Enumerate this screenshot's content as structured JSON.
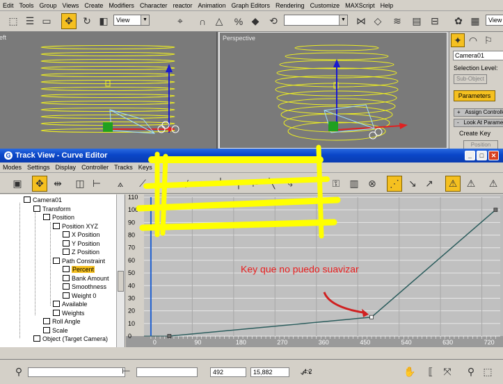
{
  "menubar": {
    "items": [
      "Edit",
      "Tools",
      "Group",
      "Views",
      "Create",
      "Modifiers",
      "Character",
      "reactor",
      "Animation",
      "Graph Editors",
      "Rendering",
      "Customize",
      "MAXScript",
      "Help"
    ]
  },
  "toolbar": {
    "view_select": "View",
    "view_select_right": "View"
  },
  "viewports": {
    "left_label": "Left",
    "persp_label": "Perspective"
  },
  "command_panel": {
    "object_name": "Camera01",
    "selection_level": "Selection Level:",
    "sub_object": "Sub-Object",
    "parameters": "Parameters",
    "rollouts": [
      "Assign Controller",
      "Look At Parameters"
    ],
    "create_key": "Create Key",
    "position": "Position"
  },
  "trackview": {
    "title": "Track View - Curve Editor",
    "menu": [
      "Modes",
      "Settings",
      "Display",
      "Controller",
      "Tracks",
      "Keys"
    ],
    "tree": [
      {
        "label": "Camera01",
        "indent": 0,
        "selected": false
      },
      {
        "label": "Transform",
        "indent": 1,
        "selected": false
      },
      {
        "label": "Position",
        "indent": 2,
        "selected": false
      },
      {
        "label": "Position XYZ",
        "indent": 3,
        "selected": false
      },
      {
        "label": "X Position",
        "indent": 4,
        "selected": false
      },
      {
        "label": "Y Position",
        "indent": 4,
        "selected": false
      },
      {
        "label": "Z Position",
        "indent": 4,
        "selected": false
      },
      {
        "label": "Path Constraint",
        "indent": 3,
        "selected": false
      },
      {
        "label": "Percent",
        "indent": 4,
        "selected": true
      },
      {
        "label": "Bank Amount",
        "indent": 4,
        "selected": false
      },
      {
        "label": "Smoothness",
        "indent": 4,
        "selected": false
      },
      {
        "label": "Weight 0",
        "indent": 4,
        "selected": false
      },
      {
        "label": "Available",
        "indent": 3,
        "selected": false
      },
      {
        "label": "Weights",
        "indent": 3,
        "selected": false
      },
      {
        "label": "Roll Angle",
        "indent": 2,
        "selected": false
      },
      {
        "label": "Scale",
        "indent": 2,
        "selected": false
      },
      {
        "label": "Object (Target Camera)",
        "indent": 1,
        "selected": false
      }
    ],
    "annotation": "Key que no puedo suavizar"
  },
  "chart_data": {
    "type": "line",
    "title": "",
    "xlabel": "",
    "ylabel": "",
    "xlim": [
      -15,
      760
    ],
    "ylim": [
      0,
      110
    ],
    "x_ticks": [
      "0",
      "90",
      "180",
      "270",
      "360",
      "450",
      "540",
      "630",
      "720"
    ],
    "y_ticks": [
      "0",
      "10",
      "20",
      "30",
      "40",
      "50",
      "60",
      "70",
      "80",
      "90",
      "100",
      "110"
    ],
    "series": [
      {
        "name": "Percent",
        "x": [
          40,
          480,
          750
        ],
        "y": [
          0,
          15,
          100
        ]
      }
    ],
    "grid": true
  },
  "status": {
    "frame_field": "492",
    "value_field": "15,882",
    "zoom_value": "4.2"
  },
  "colors": {
    "accent": "#f5c020",
    "titlebar": "#0a46c8",
    "curve": "#2a5c5c",
    "annotation": "#e82020"
  }
}
